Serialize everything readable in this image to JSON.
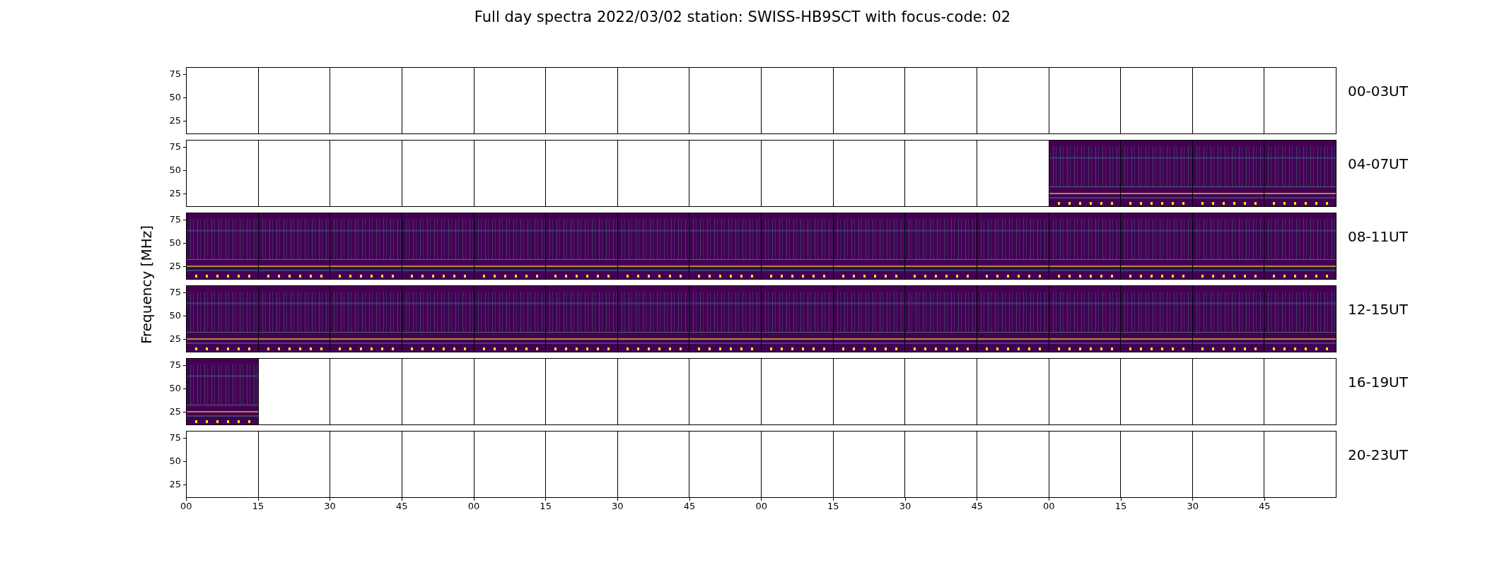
{
  "title": "Full day spectra 2022/03/02 station: SWISS-HB9SCT with focus-code: 02",
  "ylabel": "Frequency [MHz]",
  "rows": [
    {
      "label": "00-03UT",
      "yticks": [
        "75",
        "50",
        "25"
      ],
      "panels": [
        {
          "filled": false
        },
        {
          "filled": false
        },
        {
          "filled": false
        },
        {
          "filled": false
        },
        {
          "filled": false
        },
        {
          "filled": false
        },
        {
          "filled": false
        },
        {
          "filled": false
        },
        {
          "filled": false
        },
        {
          "filled": false
        },
        {
          "filled": false
        },
        {
          "filled": false
        },
        {
          "filled": false
        },
        {
          "filled": false
        },
        {
          "filled": false
        },
        {
          "filled": false
        }
      ]
    },
    {
      "label": "04-07UT",
      "yticks": [
        "75",
        "50",
        "25"
      ],
      "panels": [
        {
          "filled": false
        },
        {
          "filled": false
        },
        {
          "filled": false
        },
        {
          "filled": false
        },
        {
          "filled": false
        },
        {
          "filled": false
        },
        {
          "filled": false
        },
        {
          "filled": false
        },
        {
          "filled": false
        },
        {
          "filled": false
        },
        {
          "filled": false
        },
        {
          "filled": false
        },
        {
          "filled": true
        },
        {
          "filled": true
        },
        {
          "filled": true
        },
        {
          "filled": true
        }
      ]
    },
    {
      "label": "08-11UT",
      "yticks": [
        "75",
        "50",
        "25"
      ],
      "panels": [
        {
          "filled": true
        },
        {
          "filled": true
        },
        {
          "filled": true
        },
        {
          "filled": true
        },
        {
          "filled": true
        },
        {
          "filled": true
        },
        {
          "filled": true
        },
        {
          "filled": true
        },
        {
          "filled": true
        },
        {
          "filled": true
        },
        {
          "filled": true
        },
        {
          "filled": true
        },
        {
          "filled": true
        },
        {
          "filled": true
        },
        {
          "filled": true
        },
        {
          "filled": true
        }
      ]
    },
    {
      "label": "12-15UT",
      "yticks": [
        "75",
        "50",
        "25"
      ],
      "panels": [
        {
          "filled": true
        },
        {
          "filled": true
        },
        {
          "filled": true
        },
        {
          "filled": true
        },
        {
          "filled": true
        },
        {
          "filled": true
        },
        {
          "filled": true
        },
        {
          "filled": true
        },
        {
          "filled": true
        },
        {
          "filled": true
        },
        {
          "filled": true
        },
        {
          "filled": true
        },
        {
          "filled": true
        },
        {
          "filled": true
        },
        {
          "filled": true
        },
        {
          "filled": true
        }
      ]
    },
    {
      "label": "16-19UT",
      "yticks": [
        "75",
        "50",
        "25"
      ],
      "panels": [
        {
          "filled": true
        },
        {
          "filled": false
        },
        {
          "filled": false
        },
        {
          "filled": false
        },
        {
          "filled": false
        },
        {
          "filled": false
        },
        {
          "filled": false
        },
        {
          "filled": false
        },
        {
          "filled": false
        },
        {
          "filled": false
        },
        {
          "filled": false
        },
        {
          "filled": false
        },
        {
          "filled": false
        },
        {
          "filled": false
        },
        {
          "filled": false
        },
        {
          "filled": false
        }
      ]
    },
    {
      "label": "20-23UT",
      "yticks": [
        "75",
        "50",
        "25"
      ],
      "panels": [
        {
          "filled": false
        },
        {
          "filled": false
        },
        {
          "filled": false
        },
        {
          "filled": false
        },
        {
          "filled": false
        },
        {
          "filled": false
        },
        {
          "filled": false
        },
        {
          "filled": false
        },
        {
          "filled": false
        },
        {
          "filled": false
        },
        {
          "filled": false
        },
        {
          "filled": false
        },
        {
          "filled": false
        },
        {
          "filled": false
        },
        {
          "filled": false
        },
        {
          "filled": false
        }
      ]
    }
  ],
  "xticks": [
    "00",
    "15",
    "30",
    "45",
    "00",
    "15",
    "30",
    "45",
    "00",
    "15",
    "30",
    "45",
    "00",
    "15",
    "30",
    "45"
  ]
}
